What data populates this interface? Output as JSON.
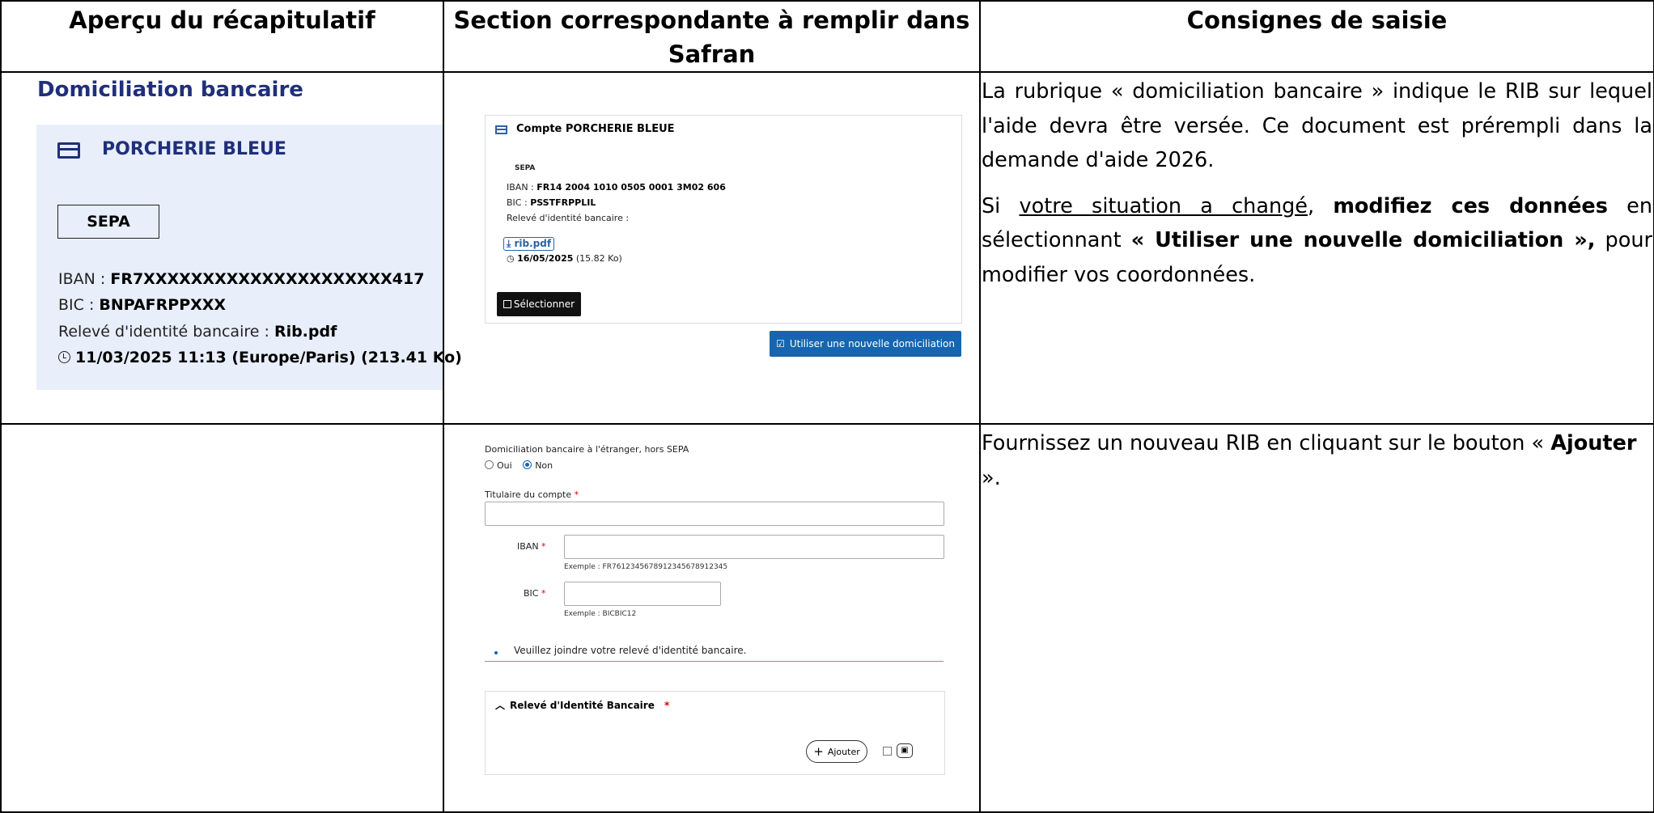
{
  "headers": {
    "col1": "Aperçu du récapitulatif",
    "col2": "Section correspondante à remplir dans Safran",
    "col3": "Consignes de saisie"
  },
  "recap": {
    "title": "Domiciliation bancaire",
    "owner": "PORCHERIE BLEUE",
    "sepa": "SEPA",
    "iban_label": "IBAN :",
    "iban_value": "FR7XXXXXXXXXXXXXXXXXXXXX417",
    "bic_label": "BIC :",
    "bic_value": "BNPAFRPPXXX",
    "rib_label": "Relevé d'identité bancaire :",
    "rib_value": "Rib.pdf",
    "date": "11/03/2025 11:13 (Europe/Paris) (213.41 Ko)"
  },
  "safran_account": {
    "title": "Compte PORCHERIE BLEUE",
    "sepa": "SEPA",
    "iban_label": "IBAN :",
    "iban_value": "FR14 2004 1010 0505 0001 3M02 606",
    "bic_label": "BIC :",
    "bic_value": "PSSTFRPPLIL",
    "rib_label": "Relevé d'identité bancaire :",
    "rib_file": "rib.pdf",
    "rib_date": "16/05/2025",
    "rib_size": "(15.82 Ko)",
    "select_label": "Sélectionner",
    "new_dom_label": "Utiliser une nouvelle domiciliation"
  },
  "safran_form": {
    "foreign_label": "Domiciliation bancaire à l'étranger, hors SEPA",
    "opt_yes": "Oui",
    "opt_no": "Non",
    "holder_label": "Titulaire du compte",
    "iban_label": "IBAN",
    "iban_hint": "Exemple : FR7612345678912345678912345",
    "bic_label": "BIC",
    "bic_hint": "Exemple : BICBIC12",
    "notice": "Veuillez joindre votre relevé d'identité bancaire.",
    "rib_panel_title": "Relevé d'Identité Bancaire",
    "add_label": "Ajouter",
    "required_mark": "*"
  },
  "instructions": {
    "p1": "La rubrique « domiciliation bancaire » indique le RIB sur lequel l'aide devra être versée. Ce document est prérempli dans la demande d'aide 2026.",
    "p2_a": "Si ",
    "p2_u": "votre situation a changé",
    "p2_b": ", ",
    "p2_bold1": "modifiez ces données",
    "p2_c": " en sélectionnant ",
    "p2_bold2": "« Utiliser une nouvelle domiciliation »,",
    "p2_d": " pour modifier vos coordonnées.",
    "p3_a": "Fournissez un nouveau RIB en cliquant sur le bouton « ",
    "p3_bold": "Ajouter",
    "p3_b": " »."
  }
}
